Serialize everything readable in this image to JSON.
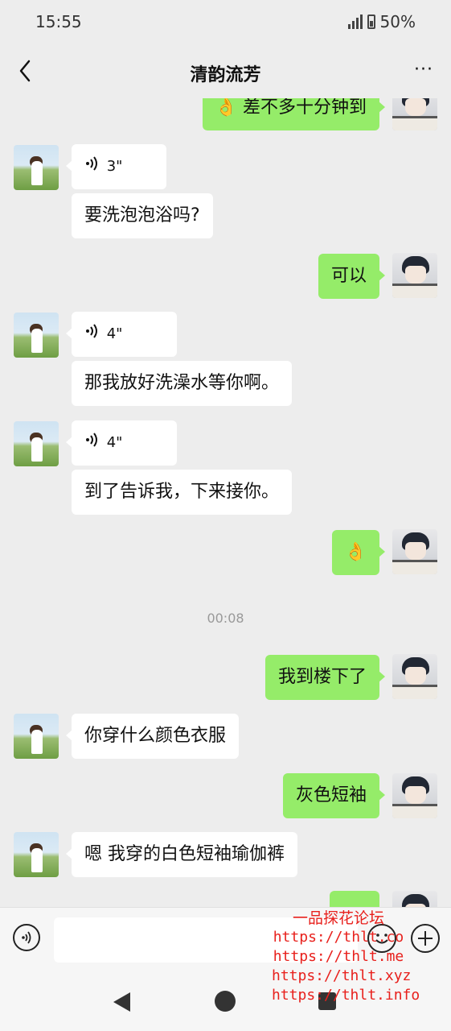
{
  "status_bar": {
    "time": "15:55",
    "battery": "50%"
  },
  "header": {
    "title": "清韵流芳",
    "more": "···"
  },
  "messages": [
    {
      "side": "right",
      "text": "👌 差不多十分钟到"
    },
    {
      "side": "left",
      "type": "voice",
      "duration": "3\""
    },
    {
      "side": "left",
      "text": "要洗泡泡浴吗?"
    },
    {
      "side": "right",
      "text": "可以"
    },
    {
      "side": "left",
      "type": "voice",
      "duration": "4\""
    },
    {
      "side": "left",
      "text": "那我放好洗澡水等你啊。"
    },
    {
      "side": "left",
      "type": "voice",
      "duration": "4\""
    },
    {
      "side": "left",
      "text": "到了告诉我，下来接你。"
    },
    {
      "side": "right",
      "text": "👌"
    },
    {
      "side": "right",
      "text": "我到楼下了"
    },
    {
      "side": "left",
      "text": "你穿什么颜色衣服"
    },
    {
      "side": "right",
      "text": "灰色短袖"
    },
    {
      "side": "left",
      "text": "嗯 我穿的白色短袖瑜伽裤"
    }
  ],
  "timestamp": "00:08",
  "input_bar": {
    "voice_icon": "voice-icon",
    "emoji_icon": "emoji-icon",
    "plus_icon": "plus-icon"
  },
  "watermark": {
    "title": "一品探花论坛",
    "urls": [
      "https://thlt.co",
      "https://thlt.me",
      "https://thlt.xyz",
      "https://thlt.info"
    ]
  },
  "colors": {
    "background": "#ededed",
    "bubble_self": "#95ec69",
    "bubble_other": "#ffffff",
    "watermark": "#e8201c"
  }
}
